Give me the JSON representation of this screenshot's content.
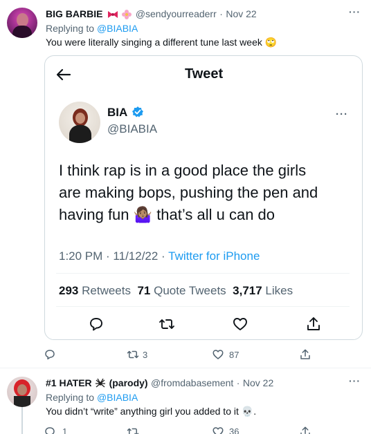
{
  "tweet1": {
    "name": "BIG BARBIE",
    "handle": "@sendyourreaderr",
    "sep": "·",
    "date": "Nov 22",
    "replying_prefix": "Replying to ",
    "replying_handle": "@BIABIA",
    "text": "You were literally singing a different tune last week",
    "text_emoji": "🙄",
    "actions": {
      "reply": "",
      "retweet": "3",
      "like": "87"
    },
    "more": "···"
  },
  "quoted": {
    "header_title": "Tweet",
    "name": "BIA",
    "handle": "@BIABIA",
    "text_line1": "I think rap is in a good place the girls",
    "text_line2": "are making bops, pushing the pen and",
    "text_line3a": "having fun",
    "text_emoji": "🤷🏽‍♀️",
    "text_line3b": "that’s all u can do",
    "time": "1:20 PM · 11/12/22 ·",
    "source": "Twitter for iPhone",
    "retweets_count": "293",
    "retweets_label": "Retweets",
    "quotes_count": "71",
    "quotes_label": "Quote Tweets",
    "likes_count": "3,717",
    "likes_label": "Likes",
    "more": "···"
  },
  "tweet2": {
    "name": "#1 HATER",
    "name_suffix": "(parody)",
    "handle": "@fromdabasement",
    "sep": "·",
    "date": "Nov 22",
    "replying_prefix": "Replying to ",
    "replying_handle": "@BIABIA",
    "text": "You didn’t “write” anything girl you added to it",
    "text_emoji": "💀",
    "text_end": ".",
    "actions": {
      "reply": "1",
      "retweet": "",
      "like": "36"
    },
    "more": "···"
  }
}
